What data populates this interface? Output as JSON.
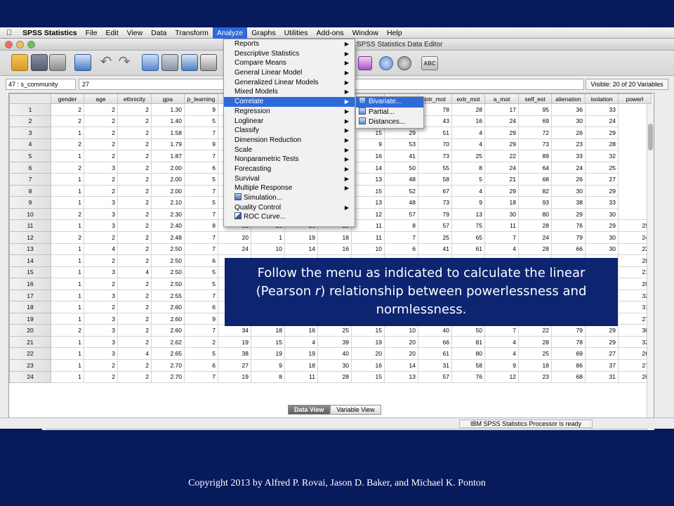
{
  "menubar": {
    "app": "SPSS Statistics",
    "items": [
      "File",
      "Edit",
      "View",
      "Data",
      "Transform",
      "Analyze",
      "Graphs",
      "Utilities",
      "Add-ons",
      "Window",
      "Help"
    ],
    "active": "Analyze"
  },
  "window": {
    "title": "SPSS Statistics Data Editor"
  },
  "toolbar": {
    "abc_label": "ABC"
  },
  "cellbar": {
    "ref": "47 : s_community",
    "value": "27",
    "visible": "Visible: 20 of 20 Variables"
  },
  "grid": {
    "columns": [
      "gender",
      "age",
      "ethnicity",
      "gpa",
      "p_learning",
      "c",
      "",
      "",
      "",
      "",
      "",
      "intr_mot",
      "extr_mot",
      "a_mot",
      "self_est",
      "alienation",
      "isolation",
      "powerl"
    ],
    "rows": [
      [
        "1",
        "2",
        "2",
        "2",
        "1.30",
        "9",
        "",
        "",
        "",
        "",
        "",
        "18",
        "78",
        "28",
        "17",
        "95",
        "36",
        "33"
      ],
      [
        "2",
        "2",
        "2",
        "2",
        "1.40",
        "5",
        "",
        "",
        "",
        "",
        "",
        "50",
        "43",
        "16",
        "24",
        "69",
        "30",
        "24"
      ],
      [
        "3",
        "1",
        "2",
        "2",
        "1.58",
        "7",
        "",
        "",
        "",
        "15",
        "15",
        "29",
        "51",
        "4",
        "29",
        "72",
        "26",
        "29"
      ],
      [
        "4",
        "2",
        "2",
        "2",
        "1.79",
        "9",
        "",
        "",
        "",
        "16",
        "9",
        "53",
        "70",
        "4",
        "29",
        "73",
        "23",
        "28"
      ],
      [
        "5",
        "1",
        "2",
        "2",
        "1.87",
        "7",
        "",
        "",
        "",
        "12",
        "16",
        "41",
        "73",
        "25",
        "22",
        "89",
        "33",
        "32"
      ],
      [
        "6",
        "2",
        "3",
        "2",
        "2.00",
        "6",
        "",
        "",
        "",
        "15",
        "14",
        "50",
        "55",
        "8",
        "24",
        "64",
        "24",
        "25"
      ],
      [
        "7",
        "1",
        "2",
        "2",
        "2.00",
        "5",
        "",
        "",
        "",
        "15",
        "13",
        "48",
        "58",
        "5",
        "21",
        "68",
        "26",
        "27"
      ],
      [
        "8",
        "1",
        "2",
        "2",
        "2.00",
        "7",
        "",
        "",
        "",
        "11",
        "15",
        "52",
        "67",
        "4",
        "29",
        "82",
        "30",
        "29"
      ],
      [
        "9",
        "1",
        "3",
        "2",
        "2.10",
        "5",
        "",
        "",
        "",
        "4",
        "13",
        "48",
        "73",
        "9",
        "18",
        "93",
        "38",
        "33"
      ],
      [
        "10",
        "2",
        "3",
        "2",
        "2.30",
        "7",
        "",
        "",
        "",
        "7",
        "12",
        "57",
        "79",
        "13",
        "30",
        "80",
        "29",
        "30"
      ],
      [
        "11",
        "1",
        "3",
        "2",
        "2.40",
        "8",
        "32",
        "16",
        "16",
        "19",
        "11",
        "8",
        "57",
        "75",
        "11",
        "28",
        "76",
        "29",
        "29"
      ],
      [
        "12",
        "2",
        "2",
        "2",
        "2.48",
        "7",
        "20",
        "1",
        "19",
        "18",
        "11",
        "7",
        "25",
        "65",
        "7",
        "24",
        "79",
        "30",
        "24"
      ],
      [
        "13",
        "1",
        "4",
        "2",
        "2.50",
        "7",
        "24",
        "10",
        "14",
        "16",
        "10",
        "6",
        "41",
        "61",
        "4",
        "28",
        "66",
        "30",
        "22"
      ],
      [
        "14",
        "1",
        "2",
        "2",
        "2.50",
        "6",
        "",
        "",
        "",
        "",
        "",
        "",
        "",
        "",
        "",
        "",
        "",
        "",
        "28"
      ],
      [
        "15",
        "1",
        "3",
        "4",
        "2.50",
        "5",
        "",
        "",
        "",
        "",
        "",
        "",
        "",
        "",
        "",
        "",
        "",
        "",
        "21"
      ],
      [
        "16",
        "1",
        "2",
        "2",
        "2.50",
        "5",
        "",
        "",
        "",
        "",
        "",
        "",
        "",
        "",
        "",
        "",
        "",
        "",
        "20"
      ],
      [
        "17",
        "1",
        "3",
        "2",
        "2.55",
        "7",
        "",
        "",
        "",
        "",
        "",
        "",
        "",
        "",
        "",
        "",
        "",
        "",
        "32"
      ],
      [
        "18",
        "1",
        "2",
        "2",
        "2.60",
        "6",
        "",
        "",
        "",
        "",
        "",
        "",
        "",
        "",
        "",
        "",
        "",
        "",
        "31"
      ],
      [
        "19",
        "1",
        "3",
        "2",
        "2.60",
        "9",
        "",
        "",
        "",
        "",
        "",
        "",
        "",
        "",
        "",
        "",
        "",
        "",
        "27"
      ],
      [
        "20",
        "2",
        "3",
        "2",
        "2.60",
        "7",
        "34",
        "18",
        "16",
        "25",
        "15",
        "10",
        "40",
        "50",
        "7",
        "22",
        "79",
        "29",
        "30"
      ],
      [
        "21",
        "1",
        "3",
        "2",
        "2.62",
        "2",
        "19",
        "15",
        "4",
        "39",
        "19",
        "20",
        "66",
        "81",
        "4",
        "28",
        "78",
        "29",
        "32"
      ],
      [
        "22",
        "1",
        "3",
        "4",
        "2.65",
        "5",
        "38",
        "19",
        "19",
        "40",
        "20",
        "20",
        "61",
        "80",
        "4",
        "25",
        "69",
        "27",
        "26"
      ],
      [
        "23",
        "1",
        "2",
        "2",
        "2.70",
        "6",
        "27",
        "9",
        "18",
        "30",
        "16",
        "14",
        "31",
        "58",
        "9",
        "18",
        "86",
        "37",
        "27"
      ],
      [
        "24",
        "1",
        "2",
        "2",
        "2.70",
        "7",
        "19",
        "8",
        "11",
        "28",
        "15",
        "13",
        "57",
        "76",
        "12",
        "23",
        "68",
        "31",
        "26"
      ]
    ]
  },
  "analyze_menu": {
    "items": [
      {
        "label": "Reports",
        "submenu": true
      },
      {
        "label": "Descriptive Statistics",
        "submenu": true
      },
      {
        "label": "Compare Means",
        "submenu": true
      },
      {
        "label": "General Linear Model",
        "submenu": true
      },
      {
        "label": "Generalized Linear Models",
        "submenu": true
      },
      {
        "label": "Mixed Models",
        "submenu": true
      },
      {
        "label": "Correlate",
        "submenu": true,
        "highlighted": true
      },
      {
        "label": "Regression",
        "submenu": true
      },
      {
        "label": "Loglinear",
        "submenu": true
      },
      {
        "label": "Classify",
        "submenu": true
      },
      {
        "label": "Dimension Reduction",
        "submenu": true
      },
      {
        "label": "Scale",
        "submenu": true
      },
      {
        "label": "Nonparametric Tests",
        "submenu": true
      },
      {
        "label": "Forecasting",
        "submenu": true
      },
      {
        "label": "Survival",
        "submenu": true
      },
      {
        "label": "Multiple Response",
        "submenu": true
      },
      {
        "label": "Simulation...",
        "submenu": false,
        "icon": "simulation-icon"
      },
      {
        "label": "Quality Control",
        "submenu": true
      },
      {
        "label": "ROC Curve...",
        "submenu": false,
        "icon": "roc-curve-icon"
      }
    ]
  },
  "correlate_submenu": {
    "items": [
      {
        "label": "Bivariate...",
        "icon": "bivariate-icon",
        "highlighted": true
      },
      {
        "label": "Partial...",
        "icon": "partial-icon"
      },
      {
        "label": "Distances...",
        "icon": "distances-icon"
      }
    ]
  },
  "view_tabs": [
    "Data View",
    "Variable View"
  ],
  "status": "IBM SPSS Statistics Processor is ready",
  "callout": {
    "line1": "Follow the menu as indicated to calculate the linear",
    "line2_pre": "(Pearson ",
    "line2_r": "r",
    "line2_post": ") relationship between powerlessness and",
    "line3": "normlessness."
  },
  "copyright": "Copyright 2013 by Alfred P. Rovai, Jason D. Baker, and Michael K. Ponton"
}
